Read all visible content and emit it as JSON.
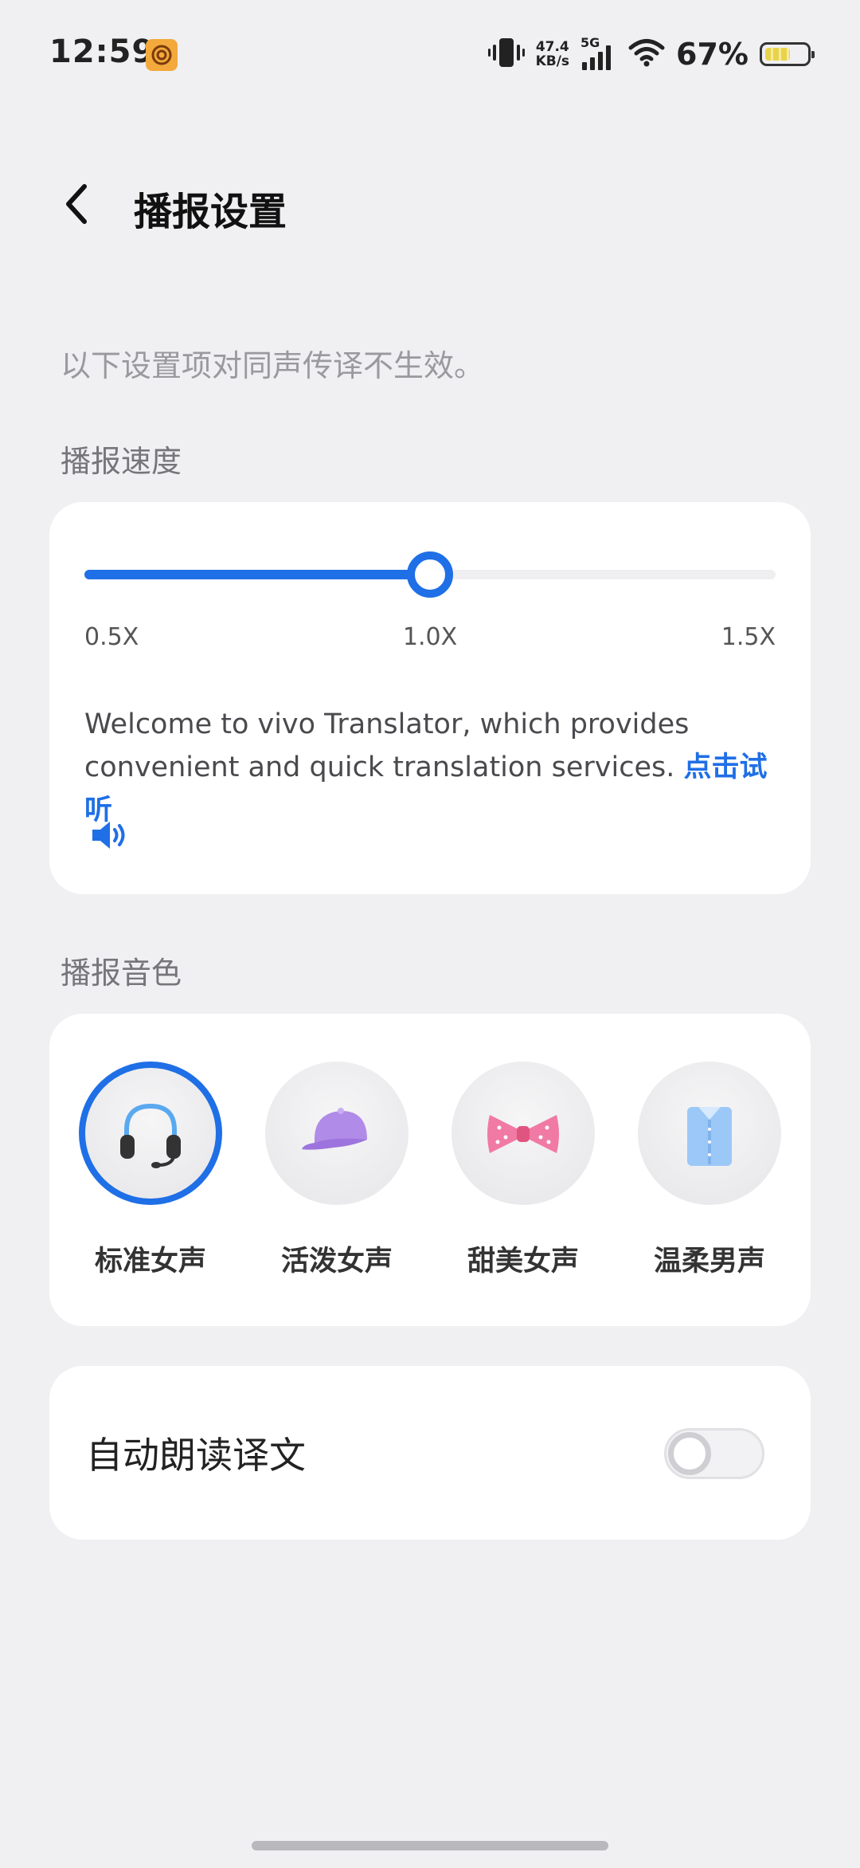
{
  "status_bar": {
    "time": "12:59",
    "net_speed_value": "47.4",
    "net_speed_unit": "KB/s",
    "network_type": "5G",
    "battery_percent": "67%",
    "battery_level": 0.67
  },
  "header": {
    "title": "播报设置"
  },
  "notice": "以下设置项对同声传译不生效。",
  "speed": {
    "section_label": "播报速度",
    "min_label": "0.5X",
    "mid_label": "1.0X",
    "max_label": "1.5X",
    "value_fraction": 0.5,
    "sample_text": "Welcome to vivo Translator, which provides convenient and quick translation services.",
    "listen_link": "点击试听",
    "accent_color": "#1f6fe6"
  },
  "voice": {
    "section_label": "播报音色",
    "items": [
      {
        "label": "标准女声",
        "icon": "headset-icon",
        "selected": true
      },
      {
        "label": "活泼女声",
        "icon": "cap-icon",
        "selected": false
      },
      {
        "label": "甜美女声",
        "icon": "bow-tie-icon",
        "selected": false
      },
      {
        "label": "温柔男声",
        "icon": "shirt-icon",
        "selected": false
      }
    ]
  },
  "auto_read": {
    "label": "自动朗读译文",
    "enabled": false
  }
}
